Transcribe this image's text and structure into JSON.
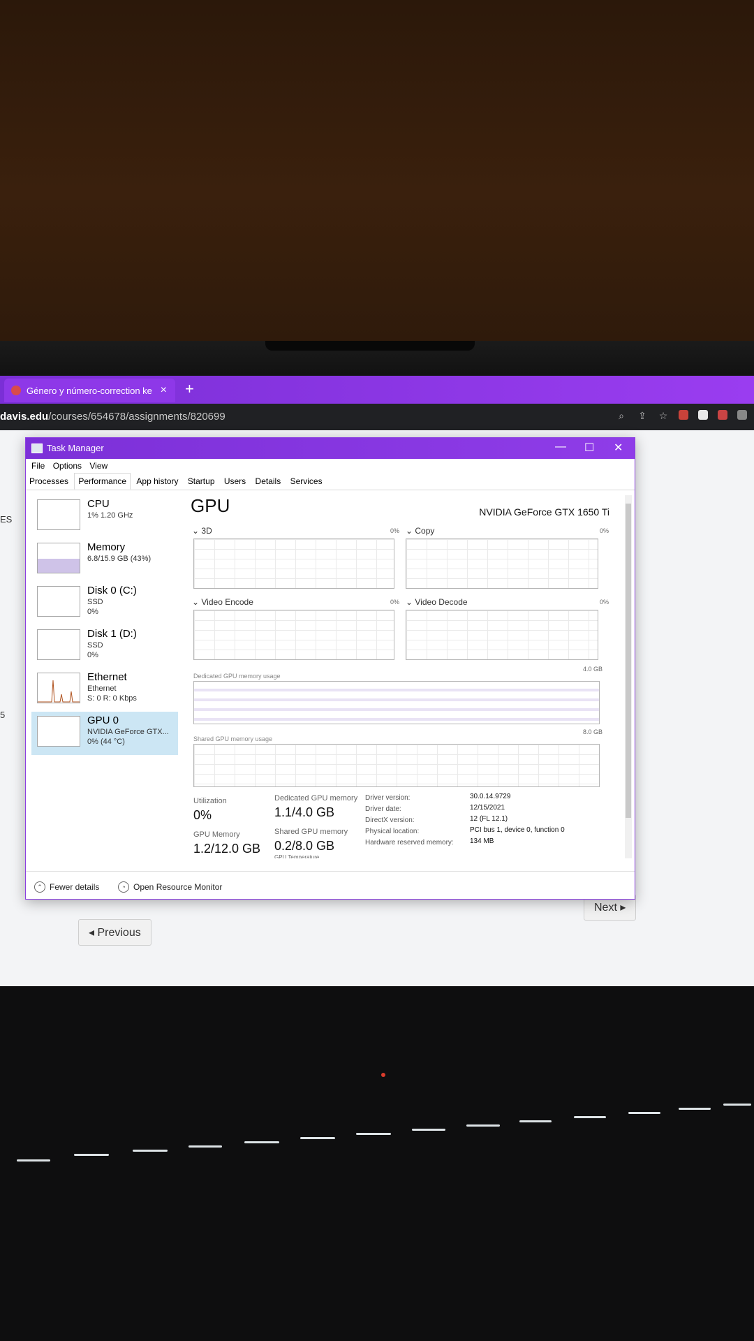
{
  "browser": {
    "tab_title": "Género y número-correction ke",
    "tab_close": "×",
    "new_tab": "+",
    "url_host": "davis.edu",
    "url_path": "/courses/654678/assignments/820699",
    "left_cut_text_1": "ES",
    "left_cut_text_2": "5"
  },
  "page_nav": {
    "previous": "◂ Previous",
    "next": "Next ▸"
  },
  "taskmanager": {
    "title": "Task Manager",
    "window_controls": {
      "minimize": "—",
      "maximize": "☐",
      "close": "✕"
    },
    "menu": [
      "File",
      "Options",
      "View"
    ],
    "tabs": [
      "Processes",
      "Performance",
      "App history",
      "Startup",
      "Users",
      "Details",
      "Services"
    ],
    "active_tab": "Performance",
    "sidebar": [
      {
        "title": "CPU",
        "sub": "1% 1.20 GHz",
        "sub2": ""
      },
      {
        "title": "Memory",
        "sub": "6.8/15.9 GB (43%)",
        "sub2": ""
      },
      {
        "title": "Disk 0 (C:)",
        "sub": "SSD",
        "sub2": "0%"
      },
      {
        "title": "Disk 1 (D:)",
        "sub": "SSD",
        "sub2": "0%"
      },
      {
        "title": "Ethernet",
        "sub": "Ethernet",
        "sub2": "S: 0 R: 0 Kbps"
      },
      {
        "title": "GPU 0",
        "sub": "NVIDIA GeForce GTX...",
        "sub2": "0% (44 °C)"
      }
    ],
    "selected_sidebar": "GPU 0",
    "main": {
      "heading": "GPU",
      "model": "NVIDIA GeForce GTX 1650 Ti",
      "graphs": [
        {
          "label": "3D",
          "pct": "0%"
        },
        {
          "label": "Copy",
          "pct": "0%"
        },
        {
          "label": "Video Encode",
          "pct": "0%"
        },
        {
          "label": "Video Decode",
          "pct": "0%"
        }
      ],
      "dedicated_label": "Dedicated GPU memory usage",
      "dedicated_cap": "4.0 GB",
      "shared_label": "Shared GPU memory usage",
      "shared_cap": "8.0 GB",
      "stats": {
        "utilization_label": "Utilization",
        "utilization": "0%",
        "dedicated_mem_label": "Dedicated GPU memory",
        "dedicated_mem": "1.1/4.0 GB",
        "gpu_memory_label": "GPU Memory",
        "gpu_memory": "1.2/12.0 GB",
        "shared_mem_label": "Shared GPU memory",
        "shared_mem": "0.2/8.0 GB",
        "temp_label_cut": "GPU Temperature"
      },
      "info": [
        {
          "label": "Driver version:",
          "value": "30.0.14.9729"
        },
        {
          "label": "Driver date:",
          "value": "12/15/2021"
        },
        {
          "label": "DirectX version:",
          "value": "12 (FL 12.1)"
        },
        {
          "label": "Physical location:",
          "value": "PCI bus 1, device 0, function 0"
        },
        {
          "label": "Hardware reserved memory:",
          "value": "134 MB"
        }
      ]
    },
    "footer": {
      "fewer_details": "Fewer details",
      "open_resource_monitor": "Open Resource Monitor"
    }
  }
}
